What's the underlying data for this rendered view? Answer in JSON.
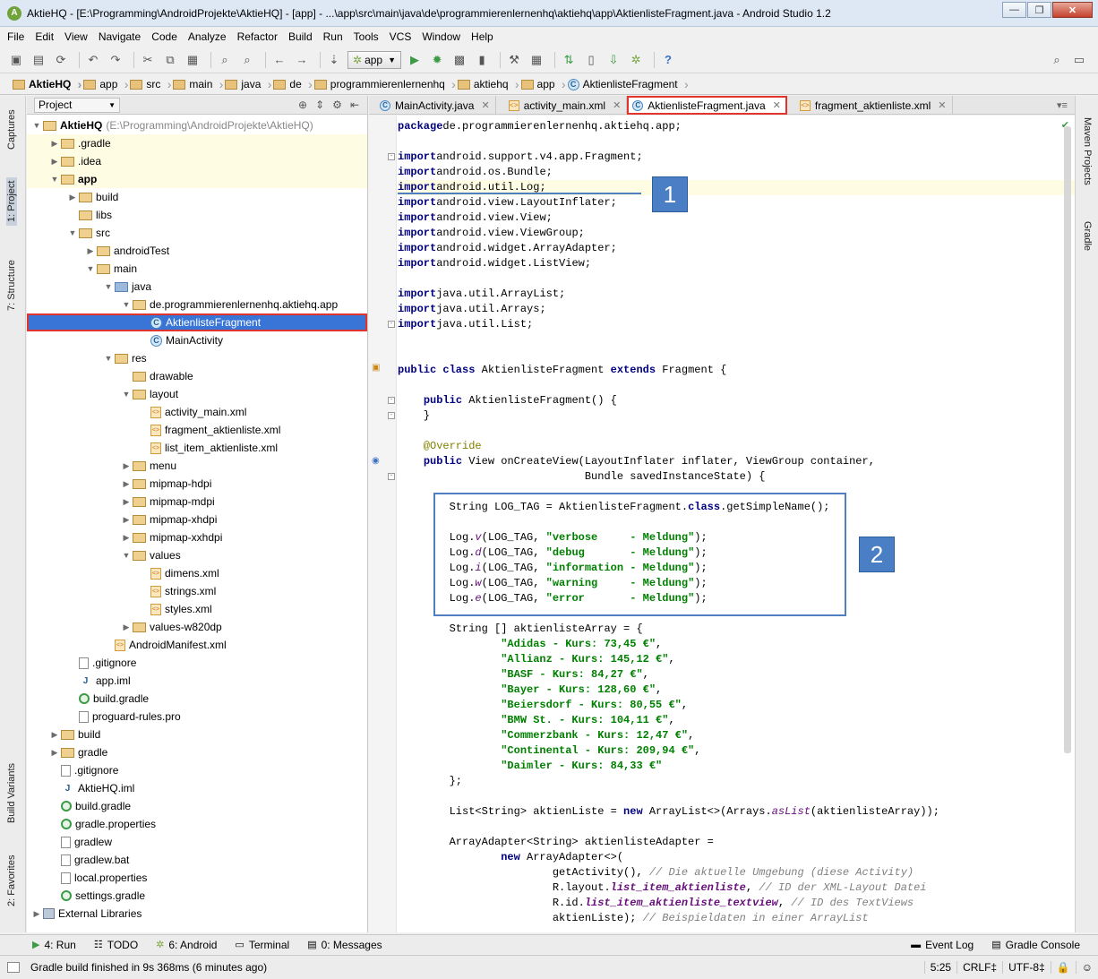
{
  "window": {
    "title": "AktieHQ - [E:\\Programming\\AndroidProjekte\\AktieHQ] - [app] - ...\\app\\src\\main\\java\\de\\programmierenlernenhq\\aktiehq\\app\\AktienlisteFragment.java - Android Studio 1.2",
    "min": "—",
    "max": "❐",
    "close": "✕"
  },
  "menu": [
    "File",
    "Edit",
    "View",
    "Navigate",
    "Code",
    "Analyze",
    "Refactor",
    "Build",
    "Run",
    "Tools",
    "VCS",
    "Window",
    "Help"
  ],
  "toolbar": {
    "run_config": "app"
  },
  "breadcrumbs": [
    "AktieHQ",
    "app",
    "src",
    "main",
    "java",
    "de",
    "programmierenlernenhq",
    "aktiehq",
    "app",
    "AktienlisteFragment"
  ],
  "left_tabs": {
    "captures": "Captures",
    "project": "1: Project",
    "structure": "7: Structure",
    "build_variants": "Build Variants",
    "favorites": "2: Favorites"
  },
  "right_tabs": {
    "maven": "Maven Projects",
    "gradle": "Gradle"
  },
  "project_panel": {
    "view_selector": "Project",
    "root_name": "AktieHQ",
    "root_path": "(E:\\Programming\\AndroidProjekte\\AktieHQ)",
    "items": [
      {
        "label": ".gradle",
        "icon": "folder",
        "depth": 1,
        "arrow": "▶"
      },
      {
        "label": ".idea",
        "icon": "folder",
        "depth": 1,
        "arrow": "▶"
      },
      {
        "label": "app",
        "icon": "folder",
        "depth": 1,
        "arrow": "▼",
        "bold": true
      },
      {
        "label": "build",
        "icon": "folder",
        "depth": 2,
        "arrow": "▶"
      },
      {
        "label": "libs",
        "icon": "folder",
        "depth": 2,
        "arrow": ""
      },
      {
        "label": "src",
        "icon": "folder",
        "depth": 2,
        "arrow": "▼"
      },
      {
        "label": "androidTest",
        "icon": "folder",
        "depth": 3,
        "arrow": "▶"
      },
      {
        "label": "main",
        "icon": "folder",
        "depth": 3,
        "arrow": "▼"
      },
      {
        "label": "java",
        "icon": "folder-src",
        "depth": 4,
        "arrow": "▼"
      },
      {
        "label": "de.programmierenlernenhq.aktiehq.app",
        "icon": "folder",
        "depth": 5,
        "arrow": "▼"
      },
      {
        "label": "AktienlisteFragment",
        "icon": "class",
        "depth": 6,
        "arrow": "",
        "selected": true
      },
      {
        "label": "MainActivity",
        "icon": "class",
        "depth": 6,
        "arrow": ""
      },
      {
        "label": "res",
        "icon": "folder-res",
        "depth": 4,
        "arrow": "▼"
      },
      {
        "label": "drawable",
        "icon": "folder",
        "depth": 5,
        "arrow": ""
      },
      {
        "label": "layout",
        "icon": "folder",
        "depth": 5,
        "arrow": "▼"
      },
      {
        "label": "activity_main.xml",
        "icon": "xml",
        "depth": 6,
        "arrow": ""
      },
      {
        "label": "fragment_aktienliste.xml",
        "icon": "xml",
        "depth": 6,
        "arrow": ""
      },
      {
        "label": "list_item_aktienliste.xml",
        "icon": "xml",
        "depth": 6,
        "arrow": ""
      },
      {
        "label": "menu",
        "icon": "folder",
        "depth": 5,
        "arrow": "▶"
      },
      {
        "label": "mipmap-hdpi",
        "icon": "folder",
        "depth": 5,
        "arrow": "▶"
      },
      {
        "label": "mipmap-mdpi",
        "icon": "folder",
        "depth": 5,
        "arrow": "▶"
      },
      {
        "label": "mipmap-xhdpi",
        "icon": "folder",
        "depth": 5,
        "arrow": "▶"
      },
      {
        "label": "mipmap-xxhdpi",
        "icon": "folder",
        "depth": 5,
        "arrow": "▶"
      },
      {
        "label": "values",
        "icon": "folder",
        "depth": 5,
        "arrow": "▼"
      },
      {
        "label": "dimens.xml",
        "icon": "xml",
        "depth": 6,
        "arrow": ""
      },
      {
        "label": "strings.xml",
        "icon": "xml",
        "depth": 6,
        "arrow": ""
      },
      {
        "label": "styles.xml",
        "icon": "xml",
        "depth": 6,
        "arrow": ""
      },
      {
        "label": "values-w820dp",
        "icon": "folder",
        "depth": 5,
        "arrow": "▶"
      },
      {
        "label": "AndroidManifest.xml",
        "icon": "xml",
        "depth": 4,
        "arrow": ""
      },
      {
        "label": ".gitignore",
        "icon": "file",
        "depth": 2,
        "arrow": ""
      },
      {
        "label": "app.iml",
        "icon": "iml",
        "depth": 2,
        "arrow": ""
      },
      {
        "label": "build.gradle",
        "icon": "gradle",
        "depth": 2,
        "arrow": ""
      },
      {
        "label": "proguard-rules.pro",
        "icon": "file",
        "depth": 2,
        "arrow": ""
      },
      {
        "label": "build",
        "icon": "folder",
        "depth": 1,
        "arrow": "▶"
      },
      {
        "label": "gradle",
        "icon": "folder",
        "depth": 1,
        "arrow": "▶"
      },
      {
        "label": ".gitignore",
        "icon": "file",
        "depth": 1,
        "arrow": ""
      },
      {
        "label": "AktieHQ.iml",
        "icon": "iml",
        "depth": 1,
        "arrow": ""
      },
      {
        "label": "build.gradle",
        "icon": "gradle",
        "depth": 1,
        "arrow": ""
      },
      {
        "label": "gradle.properties",
        "icon": "gradle",
        "depth": 1,
        "arrow": ""
      },
      {
        "label": "gradlew",
        "icon": "file",
        "depth": 1,
        "arrow": ""
      },
      {
        "label": "gradlew.bat",
        "icon": "file",
        "depth": 1,
        "arrow": ""
      },
      {
        "label": "local.properties",
        "icon": "file",
        "depth": 1,
        "arrow": ""
      },
      {
        "label": "settings.gradle",
        "icon": "gradle",
        "depth": 1,
        "arrow": ""
      },
      {
        "label": "External Libraries",
        "icon": "lib",
        "depth": 0,
        "arrow": "▶"
      }
    ]
  },
  "editor_tabs": [
    {
      "label": "MainActivity.java",
      "icon": "c",
      "active": false
    },
    {
      "label": "activity_main.xml",
      "icon": "x",
      "active": false
    },
    {
      "label": "AktienlisteFragment.java",
      "icon": "c",
      "active": true
    },
    {
      "label": "fragment_aktienliste.xml",
      "icon": "x",
      "active": false
    }
  ],
  "code_lines": [
    [
      [
        "kw",
        "package"
      ],
      [
        "",
        "de.programmierenlernenhq.aktiehq.app;"
      ]
    ],
    [],
    [
      [
        "kw",
        "import"
      ],
      [
        "",
        "android.support.v4.app.Fragment;"
      ]
    ],
    [
      [
        "kw",
        "import"
      ],
      [
        "",
        "android.os.Bundle;"
      ]
    ],
    [
      [
        "kw",
        "import"
      ],
      [
        "",
        "android.util.Log;"
      ]
    ],
    [
      [
        "kw",
        "import"
      ],
      [
        "",
        "android.view.LayoutInflater;"
      ]
    ],
    [
      [
        "kw",
        "import"
      ],
      [
        "",
        "android.view.View;"
      ]
    ],
    [
      [
        "kw",
        "import"
      ],
      [
        "",
        "android.view.ViewGroup;"
      ]
    ],
    [
      [
        "kw",
        "import"
      ],
      [
        "",
        "android.widget.ArrayAdapter;"
      ]
    ],
    [
      [
        "kw",
        "import"
      ],
      [
        "",
        "android.widget.ListView;"
      ]
    ],
    [],
    [
      [
        "kw",
        "import"
      ],
      [
        "",
        "java.util.ArrayList;"
      ]
    ],
    [
      [
        "kw",
        "import"
      ],
      [
        "",
        "java.util.Arrays;"
      ]
    ],
    [
      [
        "kw",
        "import"
      ],
      [
        "",
        "java.util.List;"
      ]
    ],
    [],
    [],
    [
      [
        "kw",
        "public class"
      ],
      [
        "",
        " AktienlisteFragment "
      ],
      [
        "kw",
        "extends"
      ],
      [
        "",
        " Fragment {"
      ]
    ],
    [],
    [
      [
        "",
        "    "
      ],
      [
        "kw",
        "public"
      ],
      [
        "",
        " AktienlisteFragment() {"
      ]
    ],
    [
      [
        "",
        "    }"
      ]
    ],
    [],
    [
      [
        "ann",
        "    @Override"
      ]
    ],
    [
      [
        "",
        "    "
      ],
      [
        "kw",
        "public"
      ],
      [
        "",
        " View onCreateView(LayoutInflater inflater, ViewGroup container,"
      ]
    ],
    [
      [
        "",
        "                             Bundle savedInstanceState) {"
      ]
    ],
    [],
    [
      [
        "",
        "        String LOG_TAG = AktienlisteFragment."
      ],
      [
        "kw",
        "class"
      ],
      [
        "",
        ".getSimpleName();"
      ]
    ],
    [],
    [
      [
        "",
        "        Log."
      ],
      [
        "fld",
        "v"
      ],
      [
        "",
        "(LOG_TAG, "
      ],
      [
        "str",
        "\"verbose     - Meldung\""
      ],
      [
        "",
        ");"
      ]
    ],
    [
      [
        "",
        "        Log."
      ],
      [
        "fld",
        "d"
      ],
      [
        "",
        "(LOG_TAG, "
      ],
      [
        "str",
        "\"debug       - Meldung\""
      ],
      [
        "",
        ");"
      ]
    ],
    [
      [
        "",
        "        Log."
      ],
      [
        "fld",
        "i"
      ],
      [
        "",
        "(LOG_TAG, "
      ],
      [
        "str",
        "\"information - Meldung\""
      ],
      [
        "",
        ");"
      ]
    ],
    [
      [
        "",
        "        Log."
      ],
      [
        "fld",
        "w"
      ],
      [
        "",
        "(LOG_TAG, "
      ],
      [
        "str",
        "\"warning     - Meldung\""
      ],
      [
        "",
        ");"
      ]
    ],
    [
      [
        "",
        "        Log."
      ],
      [
        "fld",
        "e"
      ],
      [
        "",
        "(LOG_TAG, "
      ],
      [
        "str",
        "\"error       - Meldung\""
      ],
      [
        "",
        ");"
      ]
    ],
    [],
    [
      [
        "",
        "        String [] aktienlisteArray = {"
      ]
    ],
    [
      [
        "str",
        "                \"Adidas - Kurs: 73,45 €\""
      ],
      [
        "",
        ","
      ]
    ],
    [
      [
        "str",
        "                \"Allianz - Kurs: 145,12 €\""
      ],
      [
        "",
        ","
      ]
    ],
    [
      [
        "str",
        "                \"BASF - Kurs: 84,27 €\""
      ],
      [
        "",
        ","
      ]
    ],
    [
      [
        "str",
        "                \"Bayer - Kurs: 128,60 €\""
      ],
      [
        "",
        ","
      ]
    ],
    [
      [
        "str",
        "                \"Beiersdorf - Kurs: 80,55 €\""
      ],
      [
        "",
        ","
      ]
    ],
    [
      [
        "str",
        "                \"BMW St. - Kurs: 104,11 €\""
      ],
      [
        "",
        ","
      ]
    ],
    [
      [
        "str",
        "                \"Commerzbank - Kurs: 12,47 €\""
      ],
      [
        "",
        ","
      ]
    ],
    [
      [
        "str",
        "                \"Continental - Kurs: 209,94 €\""
      ],
      [
        "",
        ","
      ]
    ],
    [
      [
        "str",
        "                \"Daimler - Kurs: 84,33 €\""
      ]
    ],
    [
      [
        "",
        "        };"
      ]
    ],
    [],
    [
      [
        "",
        "        List<String> aktienListe = "
      ],
      [
        "kw",
        "new"
      ],
      [
        "",
        " ArrayList<>(Arrays."
      ],
      [
        "fld",
        "asList"
      ],
      [
        "",
        "(aktienlisteArray));"
      ]
    ],
    [],
    [
      [
        "",
        "        ArrayAdapter<String> aktienlisteAdapter ="
      ]
    ],
    [
      [
        "",
        "                "
      ],
      [
        "kw",
        "new"
      ],
      [
        "",
        " ArrayAdapter<>("
      ]
    ],
    [
      [
        "",
        "                        getActivity(), "
      ],
      [
        "cmt",
        "// Die aktuelle Umgebung (diese Activity)"
      ]
    ],
    [
      [
        "",
        "                        R.layout."
      ],
      [
        "fldb",
        "list_item_aktienliste"
      ],
      [
        "",
        ", "
      ],
      [
        "cmt",
        "// ID der XML-Layout Datei"
      ]
    ],
    [
      [
        "",
        "                        R.id."
      ],
      [
        "fldb",
        "list_item_aktienliste_textview"
      ],
      [
        "",
        ", "
      ],
      [
        "cmt",
        "// ID des TextViews"
      ]
    ],
    [
      [
        "",
        "                        aktienListe); "
      ],
      [
        "cmt",
        "// Beispieldaten in einer ArrayList"
      ]
    ]
  ],
  "callouts": {
    "one": "1",
    "two": "2"
  },
  "bottom_tabs": [
    {
      "label": "4: Run",
      "icon": "▶"
    },
    {
      "label": "TODO",
      "icon": "☷"
    },
    {
      "label": "6: Android",
      "icon": "✲"
    },
    {
      "label": "Terminal",
      "icon": "▭"
    },
    {
      "label": "0: Messages",
      "icon": "▤"
    }
  ],
  "bottom_right_tabs": [
    {
      "label": "Event Log",
      "icon": "▬"
    },
    {
      "label": "Gradle Console",
      "icon": "▤"
    }
  ],
  "status": {
    "message": "Gradle build finished in 9s 368ms (6 minutes ago)",
    "position": "5:25",
    "line_sep": "CRLF‡",
    "encoding": "UTF-8‡"
  }
}
